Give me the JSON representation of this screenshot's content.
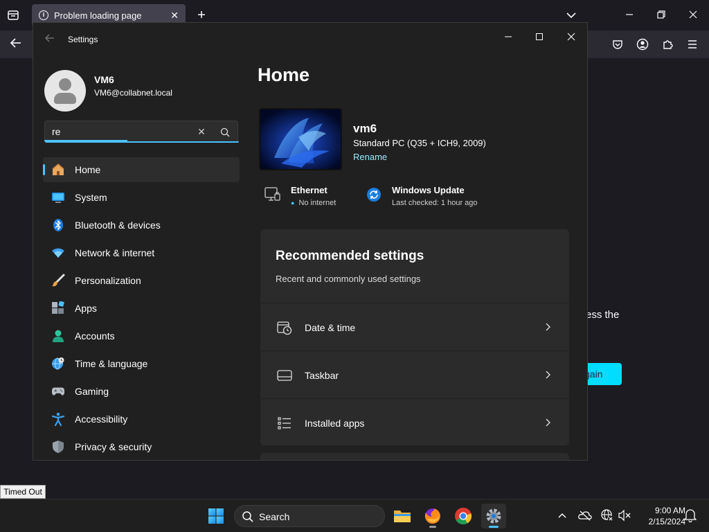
{
  "browser": {
    "tab_title": "Problem loading page",
    "tab_close": "✕",
    "new_tab": "+",
    "content_text": "ess the",
    "try_again_label": "gain"
  },
  "settings": {
    "app_title": "Settings",
    "window_controls": {
      "minimize": "—",
      "maximize": "☐",
      "close": "✕"
    },
    "profile": {
      "name": "VM6",
      "email": "VM6@collabnet.local"
    },
    "search": {
      "value": "re",
      "clear": "✕"
    },
    "nav": [
      {
        "label": "Home",
        "icon": "home-icon",
        "active": true
      },
      {
        "label": "System",
        "icon": "system-icon"
      },
      {
        "label": "Bluetooth & devices",
        "icon": "bluetooth-icon"
      },
      {
        "label": "Network & internet",
        "icon": "network-icon"
      },
      {
        "label": "Personalization",
        "icon": "brush-icon"
      },
      {
        "label": "Apps",
        "icon": "apps-icon"
      },
      {
        "label": "Accounts",
        "icon": "accounts-icon"
      },
      {
        "label": "Time & language",
        "icon": "globe-clock-icon"
      },
      {
        "label": "Gaming",
        "icon": "gamepad-icon"
      },
      {
        "label": "Accessibility",
        "icon": "accessibility-icon"
      },
      {
        "label": "Privacy & security",
        "icon": "shield-icon"
      }
    ],
    "home": {
      "title": "Home",
      "device": {
        "name": "vm6",
        "model": "Standard PC (Q35 + ICH9, 2009)",
        "rename": "Rename"
      },
      "ethernet": {
        "title": "Ethernet",
        "status": "No internet"
      },
      "windows_update": {
        "title": "Windows Update",
        "status": "Last checked: 1 hour ago"
      },
      "recommended": {
        "title": "Recommended settings",
        "subtitle": "Recent and commonly used settings",
        "items": [
          {
            "label": "Date & time",
            "icon": "calendar-clock-icon"
          },
          {
            "label": "Taskbar",
            "icon": "taskbar-icon"
          },
          {
            "label": "Installed apps",
            "icon": "list-icon"
          }
        ]
      }
    }
  },
  "tooltip": "Timed Out",
  "taskbar": {
    "search_placeholder": "Search",
    "clock_time": "9:00 AM",
    "clock_date": "2/15/2024"
  },
  "colors": {
    "accent": "#4cc2ff",
    "link": "#99ebff",
    "firefox_button": "#00ddff"
  }
}
